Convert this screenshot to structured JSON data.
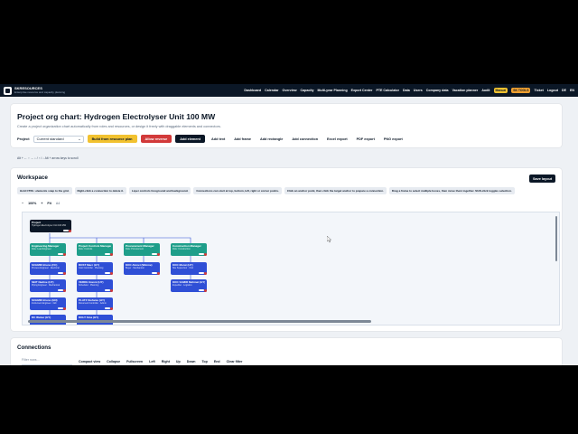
{
  "topbar": {
    "brand_name": "SKRESOURCES",
    "brand_tagline": "Enterprise resource and capacity planning",
    "nav": [
      "Dashboard",
      "Calendar",
      "Overview",
      "Capacity",
      "Multi-year Planning",
      "Export Center",
      "PTE Calculator",
      "Data",
      "Users",
      "Company data",
      "Vacation planner",
      "Audit"
    ],
    "manual_label": "Manual",
    "tools_label": "SK TOOLS",
    "right_nav": [
      "Ticket",
      "Logout",
      "DE",
      "EN"
    ]
  },
  "header": {
    "title": "Project org chart: Hydrogen Electrolyser Unit 100 MW",
    "subtitle": "Create a project organization chart automatically from roles and resources, or design it freely with draggable elements and connectors.",
    "project_label": "Project",
    "project_select": "Current standard",
    "buttons": {
      "build": "Build from resource plan",
      "allow_reverse": "Allow reverse",
      "add_element": "Add element",
      "add_text": "Add text",
      "add_frame": "Add frame",
      "add_rectangle": "Add rectangle",
      "add_connection": "Add connection",
      "excel_export": "Excel export",
      "pdf_export": "PDF export",
      "png_export": "PNG export"
    }
  },
  "breadcrumb": "Alt + ← ↑ → ↓ / ↑ / ↓ Alt + arrow keys to scroll",
  "workspace": {
    "title": "Workspace",
    "save_layout": "Save layout",
    "hints": [
      "Hold CTRL: elements snap to the grid.",
      "Right-click a connection to delete it.",
      "Layer controls foreground and background.",
      "Connections can start at top, bottom, left, right or corner points.",
      "Click an anchor point, then click the target anchor to prepare a connection.",
      "Drag a frame to select multiple boxes, then move them together. Shift-click toggles selection."
    ],
    "zoom": {
      "minus": "−",
      "value": "100%",
      "plus": "+",
      "fit": "Fit",
      "info": "A4"
    },
    "nodes": [
      {
        "title": "Project",
        "sub": "Hydrogen Electrolyser Unit 100 MW",
        "color": "dark"
      },
      {
        "title": "Engineering Manager",
        "sub": "Role: Lead Engineer",
        "color": "teal"
      },
      {
        "title": "Project Controls Manager",
        "sub": "Role: Controls",
        "color": "teal"
      },
      {
        "title": "Procurement Manager",
        "sub": "Role: Procurement",
        "color": "teal"
      },
      {
        "title": "Construction Manager",
        "sub": "Role: Construction",
        "color": "teal"
      },
      {
        "title": "SCHMID Bruno (FC)",
        "sub": "Process Engineer · Electrical",
        "color": "blue"
      },
      {
        "title": "ROST Marc (HY)",
        "sub": "Cost Controller · Planning",
        "color": "blue"
      },
      {
        "title": "KOC Ahmet (Wärme)",
        "sub": "Buyer · Mechanical",
        "color": "blue"
      },
      {
        "title": "KOC Murat (HY)",
        "sub": "Site Supervisor · Civil",
        "color": "blue"
      },
      {
        "title": "SEIT Nadine (HY)",
        "sub": "Piping Engineer · Mechanical",
        "color": "blue"
      },
      {
        "title": "VERDE Gianni (HY)",
        "sub": "Scheduler · Planning",
        "color": "blue"
      },
      {
        "title": "KOC SAMIR Mehmet (HY)",
        "sub": "Expediter · Logistics",
        "color": "blue"
      },
      {
        "title": "KOC SAMIR Mehmet (HY)",
        "sub": "QA/QC Inspector · Quality",
        "color": "blue"
      },
      {
        "title": "SCHMID Bruno (EN)",
        "sub": "Instrument Engineer · I&C",
        "color": "blue"
      },
      {
        "title": "PLATZ Stefanie (HY)",
        "sub": "Document Controller · Admin",
        "color": "blue"
      },
      {
        "title": "DC Weber (HY)",
        "sub": "",
        "color": "blue"
      },
      {
        "title": "DOLT Sina (HY)",
        "sub": "",
        "color": "blue"
      }
    ]
  },
  "connections": {
    "title": "Connections",
    "filter_placeholder": "Filter rows...",
    "controls": [
      "Compact view",
      "Collapse",
      "Fullscreen",
      "Left",
      "Right",
      "Up",
      "Down",
      "Top",
      "End",
      "Clear filter"
    ]
  }
}
